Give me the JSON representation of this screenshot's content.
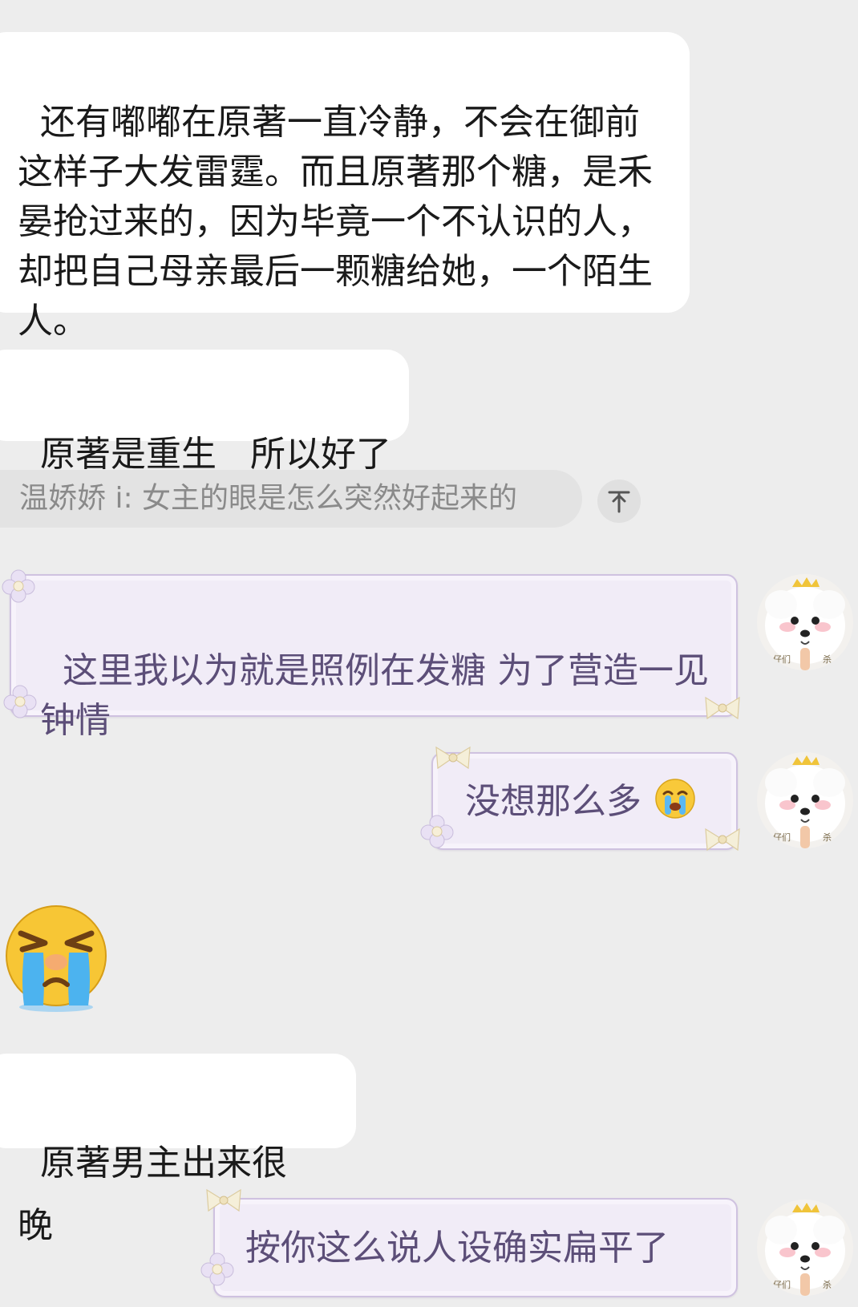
{
  "messages": {
    "m1": "还有嘟嘟在原著一直冷静，不会在御前这样子大发雷霆。而且原著那个糖，是禾晏抢过来的，因为毕竟一个不认识的人，却把自己母亲最后一颗糖给她，一个陌生人。",
    "m2": "原著是重生   所以好了",
    "quote": "温娇娇 i: 女主的眼是怎么突然好起来的",
    "m3": "这里我以为就是照例在发糖 为了营造一见钟情",
    "m4": "没想那么多",
    "m5": "原著男主出来很晚",
    "m6": "按你这么说人设确实扁平了"
  },
  "colors": {
    "background": "#ededed",
    "incoming_bubble": "#ffffff",
    "decorated_bubble": "#f1ecf7",
    "decorated_text": "#5c4e78"
  },
  "icons": {
    "quote_jump": "arrow-up-icon",
    "emoji_inline": "crying-face-icon",
    "emoji_sticker": "crying-squint-face-icon",
    "avatar": "white-dog-avatar"
  }
}
